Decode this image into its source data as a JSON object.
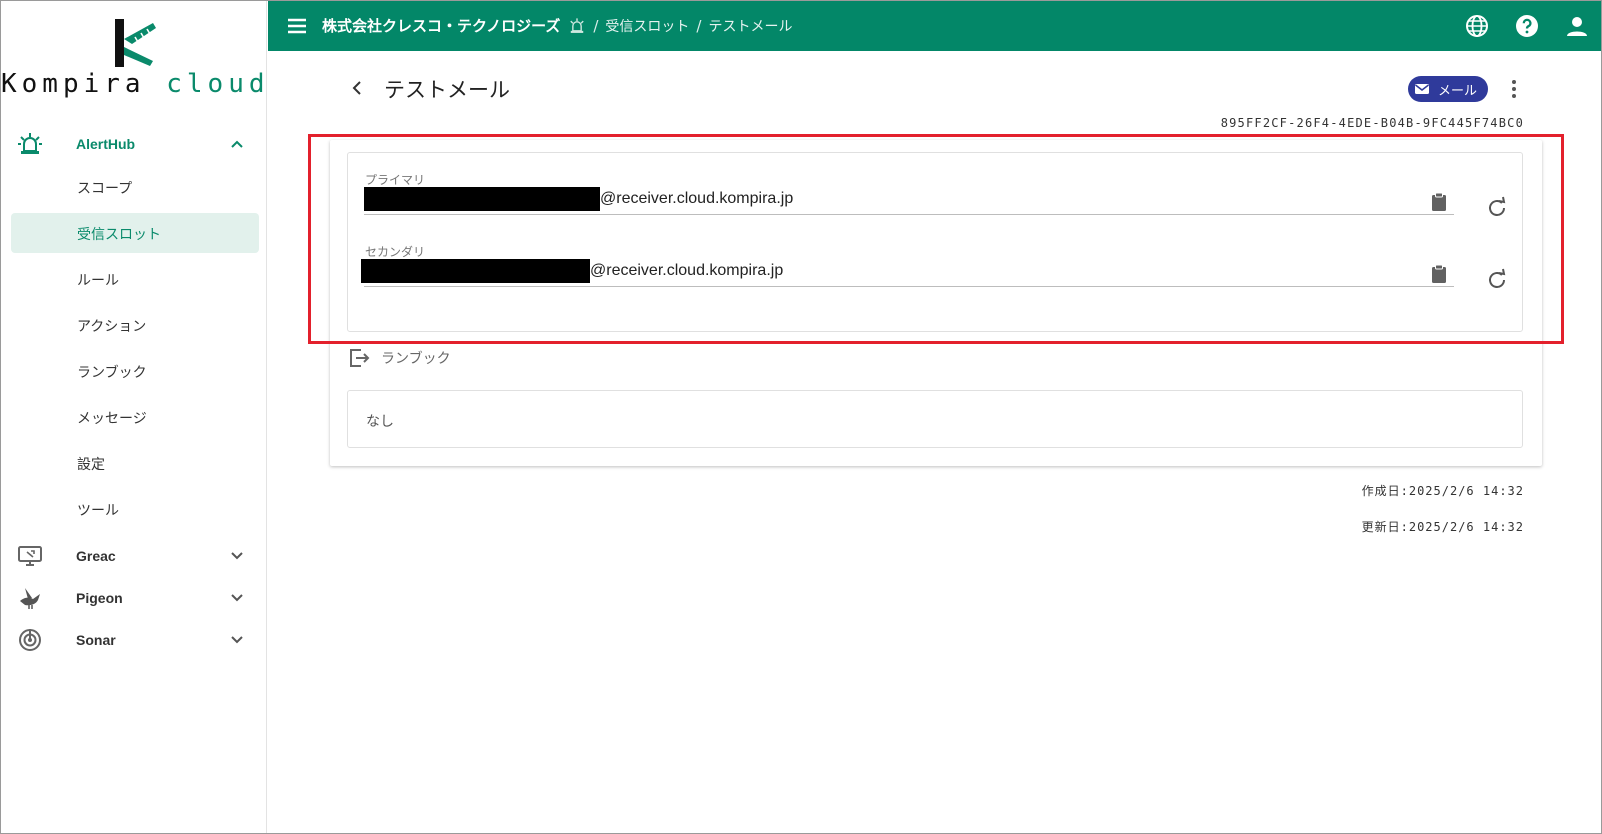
{
  "brand": {
    "name_main": "Kompira",
    "name_sub": "cloud",
    "accent": "#038768"
  },
  "sidebar": {
    "groups": [
      {
        "label": "AlertHub",
        "icon": "siren-icon",
        "expanded": true
      },
      {
        "label": "Greac",
        "icon": "monitor-icon",
        "expanded": false
      },
      {
        "label": "Pigeon",
        "icon": "pigeon-icon",
        "expanded": false
      },
      {
        "label": "Sonar",
        "icon": "radar-icon",
        "expanded": false
      }
    ],
    "items": [
      "スコープ",
      "受信スロット",
      "ルール",
      "アクション",
      "ランブック",
      "メッセージ",
      "設定",
      "ツール"
    ],
    "selected_item": "受信スロット"
  },
  "header": {
    "org": "株式会社クレスコ・テクノロジーズ",
    "crumb_1": "受信スロット",
    "crumb_2": "テストメール",
    "separator": "/"
  },
  "page": {
    "title": "テストメール",
    "type_chip": "メール",
    "uuid": "895FF2CF-26F4-4EDE-B04B-9FC445F74BC0"
  },
  "addresses": {
    "primary": {
      "label": "プライマリ",
      "domain": "@receiver.cloud.kompira.jp"
    },
    "secondary": {
      "label": "セカンダリ",
      "domain": "@receiver.cloud.kompira.jp"
    }
  },
  "runbook": {
    "heading": "ランブック",
    "value": "なし"
  },
  "meta": {
    "created": "作成日:2025/2/6 14:32",
    "updated": "更新日:2025/2/6 14:32"
  }
}
